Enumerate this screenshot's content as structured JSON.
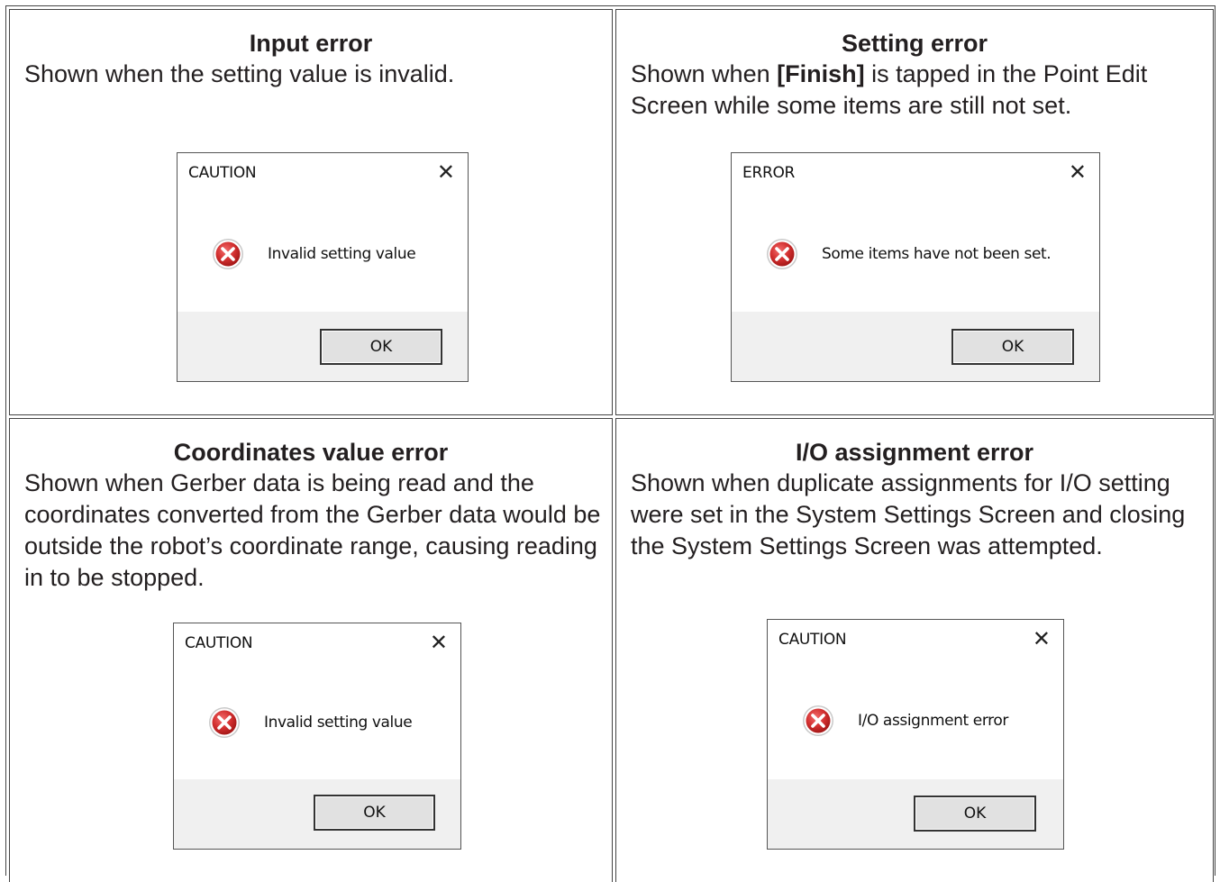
{
  "cells": [
    {
      "title": "Input error",
      "description": "Shown when the setting value is invalid.",
      "dialog": {
        "title": "CAUTION",
        "close": "✕",
        "message": "Invalid setting value",
        "ok": "OK",
        "icon": "error-icon"
      }
    },
    {
      "title": "Setting error",
      "description_before": "Shown when ",
      "description_bold": "[Finish]",
      "description_after": " is tapped in the Point Edit Screen while some items are still not set.",
      "dialog": {
        "title": "ERROR",
        "close": "✕",
        "message": "Some items have not been set.",
        "ok": "OK",
        "icon": "error-icon"
      }
    },
    {
      "title": "Coordinates value error",
      "description": "Shown when Gerber data is being read and the coordinates converted from the Gerber data would be outside the robot’s coordinate range, causing reading in to be stopped.",
      "dialog": {
        "title": "CAUTION",
        "close": "✕",
        "message": "Invalid setting value",
        "ok": "OK",
        "icon": "error-icon"
      }
    },
    {
      "title": "I/O assignment error",
      "description": "Shown when duplicate assignments for I/O setting were set in the System Settings Screen and closing the System Settings Screen was attempted.",
      "dialog": {
        "title": "CAUTION",
        "close": "✕",
        "message": "I/O assignment error",
        "ok": "OK",
        "icon": "error-icon"
      }
    }
  ],
  "colors": {
    "error_red": "#c42b1c",
    "footer": "#f0f0f0",
    "button": "#e1e1e1"
  }
}
